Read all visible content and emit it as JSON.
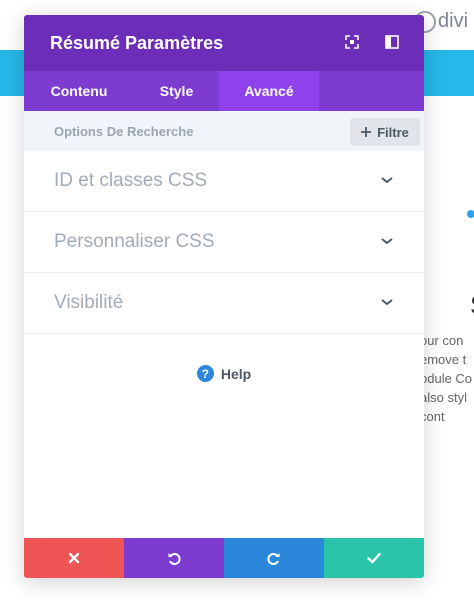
{
  "background": {
    "logo_text": "divi",
    "heading_fragment": "S",
    "body_lines": "our con\nemove t\nodule Co\nalso styl\ncont"
  },
  "modal": {
    "title": "Résumé Paramètres",
    "header_icons": [
      "fullscreen-icon",
      "sidebar-layout-icon"
    ],
    "tabs": [
      {
        "label": "Contenu",
        "active": false
      },
      {
        "label": "Style",
        "active": false
      },
      {
        "label": "Avancé",
        "active": true
      }
    ],
    "search": {
      "placeholder": "Options De Recherche",
      "filter_label": "Filtre",
      "filter_icon": "plus-icon"
    },
    "sections": [
      {
        "label": "ID et classes CSS",
        "icon": "chevron-down-icon"
      },
      {
        "label": "Personnaliser CSS",
        "icon": "chevron-down-icon"
      },
      {
        "label": "Visibilité",
        "icon": "chevron-down-icon"
      }
    ],
    "help": {
      "label": "Help",
      "icon": "question-icon",
      "icon_glyph": "?"
    },
    "footer": [
      {
        "name": "discard-button",
        "icon": "close-icon",
        "color": "#ef5555"
      },
      {
        "name": "undo-button",
        "icon": "undo-icon",
        "color": "#7e3bd0"
      },
      {
        "name": "redo-button",
        "icon": "redo-icon",
        "color": "#2b87da"
      },
      {
        "name": "save-button",
        "icon": "check-icon",
        "color": "#29c4a9"
      }
    ]
  },
  "colors": {
    "header": "#6c2eb9",
    "tabs": "#7e3bd0",
    "active_tab": "#8f42ec",
    "banner": "#25b8e8"
  }
}
